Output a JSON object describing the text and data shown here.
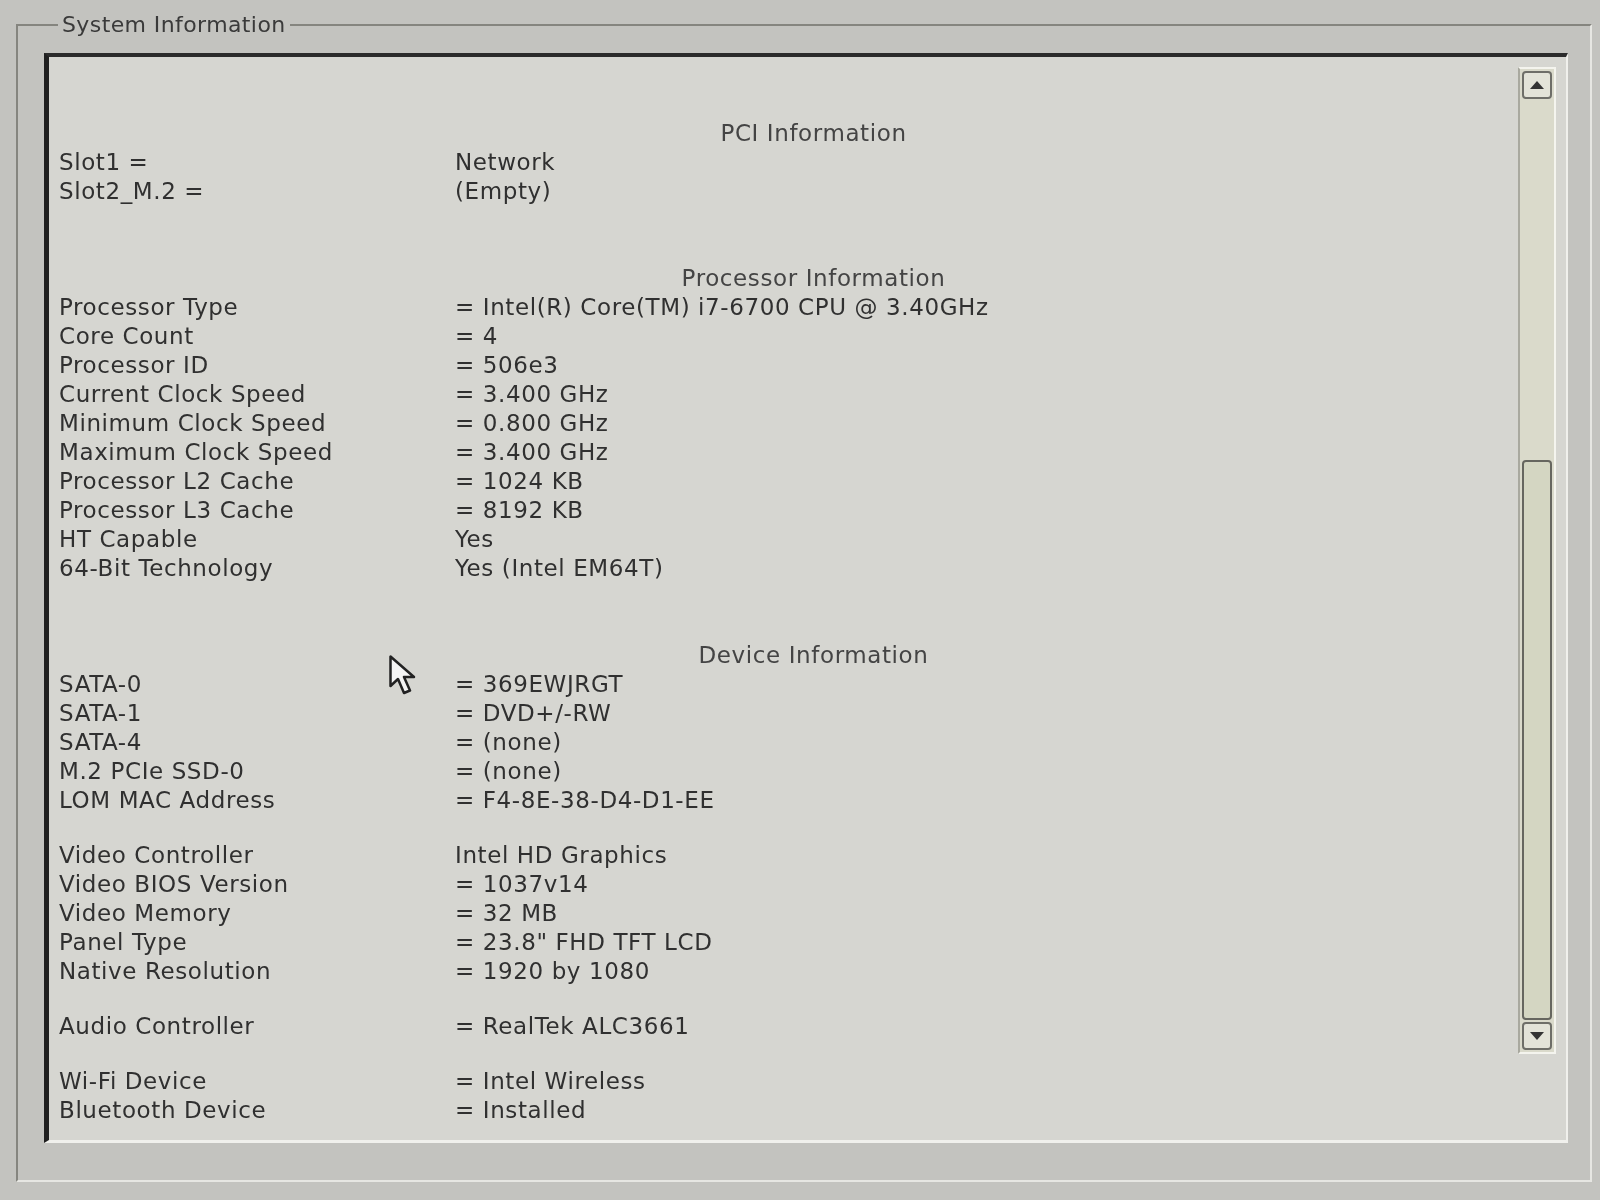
{
  "group_box": {
    "title": "System Information"
  },
  "sections": [
    {
      "heading": "PCI Information",
      "groups": [
        {
          "rows": [
            {
              "label": "Slot1 =",
              "value": "Network"
            },
            {
              "label": "Slot2_M.2 =",
              "value": "(Empty)"
            }
          ]
        }
      ]
    },
    {
      "heading": "Processor Information",
      "groups": [
        {
          "rows": [
            {
              "label": "Processor Type",
              "value": "= Intel(R) Core(TM) i7-6700 CPU @ 3.40GHz"
            },
            {
              "label": "Core Count",
              "value": "= 4"
            },
            {
              "label": "Processor ID",
              "value": "= 506e3"
            },
            {
              "label": "Current Clock Speed",
              "value": "= 3.400 GHz"
            },
            {
              "label": "Minimum Clock Speed",
              "value": "= 0.800 GHz"
            },
            {
              "label": "Maximum Clock Speed",
              "value": "= 3.400 GHz"
            },
            {
              "label": "Processor L2 Cache",
              "value": "= 1024 KB"
            },
            {
              "label": "Processor L3 Cache",
              "value": "= 8192 KB"
            },
            {
              "label": "HT Capable",
              "value": "Yes"
            },
            {
              "label": "64-Bit Technology",
              "value": "Yes (Intel EM64T)"
            }
          ]
        }
      ]
    },
    {
      "heading": "Device Information",
      "groups": [
        {
          "rows": [
            {
              "label": "SATA-0",
              "value": "= 369EWJRGT"
            },
            {
              "label": "SATA-1",
              "value": "= DVD+/-RW"
            },
            {
              "label": "SATA-4",
              "value": "= (none)"
            },
            {
              "label": "M.2 PCIe SSD-0",
              "value": "= (none)"
            },
            {
              "label": "LOM MAC Address",
              "value": "= F4-8E-38-D4-D1-EE"
            }
          ]
        },
        {
          "rows": [
            {
              "label": "Video Controller",
              "value": "Intel HD Graphics"
            },
            {
              "label": "Video BIOS Version",
              "value": "= 1037v14"
            },
            {
              "label": "Video Memory",
              "value": "= 32 MB"
            },
            {
              "label": "Panel Type",
              "value": "= 23.8\" FHD TFT LCD"
            },
            {
              "label": "Native Resolution",
              "value": "= 1920 by 1080"
            }
          ]
        },
        {
          "rows": [
            {
              "label": "Audio Controller",
              "value": "= RealTek ALC3661"
            }
          ]
        },
        {
          "rows": [
            {
              "label": "Wi-Fi Device",
              "value": "= Intel Wireless"
            },
            {
              "label": "Bluetooth Device",
              "value": "= Installed"
            }
          ]
        }
      ]
    }
  ]
}
